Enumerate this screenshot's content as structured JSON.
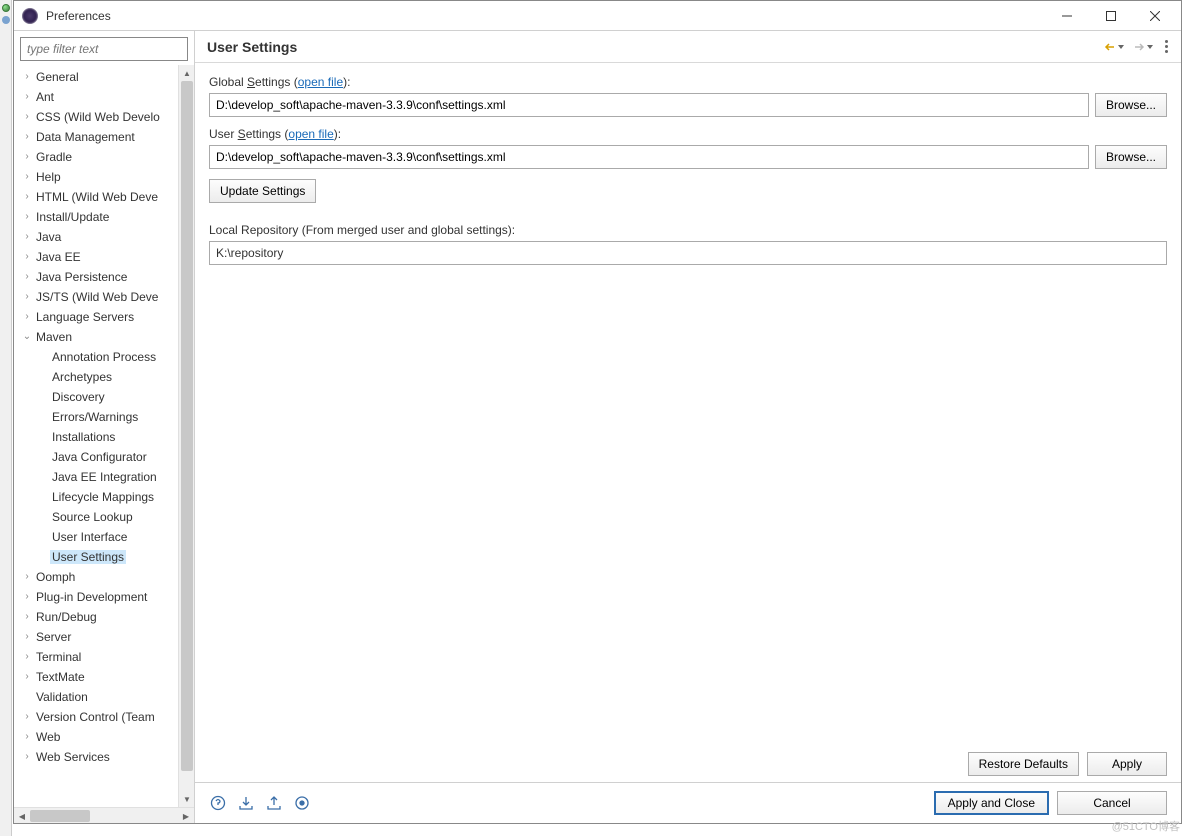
{
  "window": {
    "title": "Preferences"
  },
  "filter": {
    "placeholder": "type filter text"
  },
  "tree": [
    {
      "label": "General",
      "ind": 0,
      "tw": ">"
    },
    {
      "label": "Ant",
      "ind": 0,
      "tw": ">"
    },
    {
      "label": "CSS (Wild Web Develo",
      "ind": 0,
      "tw": ">"
    },
    {
      "label": "Data Management",
      "ind": 0,
      "tw": ">"
    },
    {
      "label": "Gradle",
      "ind": 0,
      "tw": ">"
    },
    {
      "label": "Help",
      "ind": 0,
      "tw": ">"
    },
    {
      "label": "HTML (Wild Web Deve",
      "ind": 0,
      "tw": ">"
    },
    {
      "label": "Install/Update",
      "ind": 0,
      "tw": ">"
    },
    {
      "label": "Java",
      "ind": 0,
      "tw": ">"
    },
    {
      "label": "Java EE",
      "ind": 0,
      "tw": ">"
    },
    {
      "label": "Java Persistence",
      "ind": 0,
      "tw": ">"
    },
    {
      "label": "JS/TS (Wild Web Deve",
      "ind": 0,
      "tw": ">"
    },
    {
      "label": "Language Servers",
      "ind": 0,
      "tw": ">"
    },
    {
      "label": "Maven",
      "ind": 0,
      "tw": "v"
    },
    {
      "label": "Annotation Process",
      "ind": 1,
      "tw": ""
    },
    {
      "label": "Archetypes",
      "ind": 1,
      "tw": ""
    },
    {
      "label": "Discovery",
      "ind": 1,
      "tw": ""
    },
    {
      "label": "Errors/Warnings",
      "ind": 1,
      "tw": ""
    },
    {
      "label": "Installations",
      "ind": 1,
      "tw": ""
    },
    {
      "label": "Java Configurator",
      "ind": 1,
      "tw": ""
    },
    {
      "label": "Java EE Integration",
      "ind": 1,
      "tw": ""
    },
    {
      "label": "Lifecycle Mappings",
      "ind": 1,
      "tw": ""
    },
    {
      "label": "Source Lookup",
      "ind": 1,
      "tw": ""
    },
    {
      "label": "User Interface",
      "ind": 1,
      "tw": ""
    },
    {
      "label": "User Settings",
      "ind": 1,
      "tw": "",
      "selected": true
    },
    {
      "label": "Oomph",
      "ind": 0,
      "tw": ">"
    },
    {
      "label": "Plug-in Development",
      "ind": 0,
      "tw": ">"
    },
    {
      "label": "Run/Debug",
      "ind": 0,
      "tw": ">"
    },
    {
      "label": "Server",
      "ind": 0,
      "tw": ">"
    },
    {
      "label": "Terminal",
      "ind": 0,
      "tw": ">"
    },
    {
      "label": "TextMate",
      "ind": 0,
      "tw": ">"
    },
    {
      "label": "Validation",
      "ind": 0,
      "tw": ""
    },
    {
      "label": "Version Control (Team",
      "ind": 0,
      "tw": ">"
    },
    {
      "label": "Web",
      "ind": 0,
      "tw": ">"
    },
    {
      "label": "Web Services",
      "ind": 0,
      "tw": ">"
    }
  ],
  "page": {
    "title": "User Settings",
    "global_prefix": "Global ",
    "global_accessor": "S",
    "global_suffix": "ettings",
    "open_file": "open file",
    "global_value": "D:\\develop_soft\\apache-maven-3.3.9\\conf\\settings.xml",
    "user_prefix": "User ",
    "user_accessor": "S",
    "user_suffix": "ettings",
    "user_value": "D:\\develop_soft\\apache-maven-3.3.9\\conf\\settings.xml",
    "browse": "Browse...",
    "update": "Update Settings",
    "local_label": "Local Repository (From merged user and global settings):",
    "local_value": "K:\\repository",
    "restore": "Restore Defaults",
    "apply": "Apply",
    "apply_close": "Apply and Close",
    "cancel": "Cancel"
  },
  "watermark": "@51CTO博客"
}
